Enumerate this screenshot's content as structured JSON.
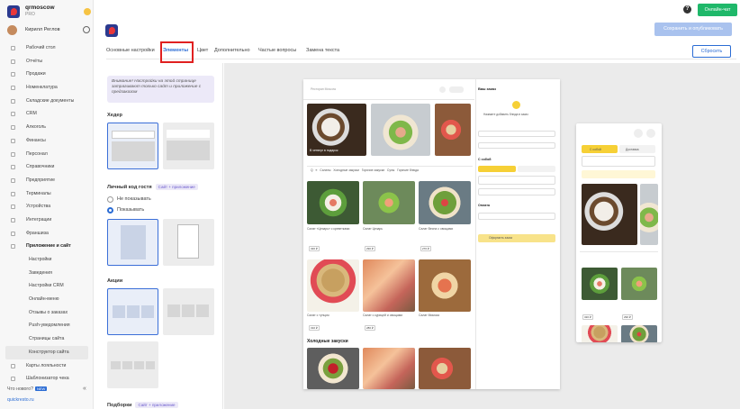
{
  "brand": {
    "name": "qrmoscow",
    "plan": "PRO"
  },
  "user": {
    "name": "Кирилл Реглов"
  },
  "menu": [
    {
      "label": "Рабочий стол",
      "type": "main"
    },
    {
      "label": "Отчёты",
      "type": "main"
    },
    {
      "label": "Продажи",
      "type": "main"
    },
    {
      "label": "Номенклатура",
      "type": "main"
    },
    {
      "label": "Складские документы",
      "type": "main"
    },
    {
      "label": "CRM",
      "type": "main"
    },
    {
      "label": "Алкоголь",
      "type": "main"
    },
    {
      "label": "Финансы",
      "type": "main"
    },
    {
      "label": "Персонал",
      "type": "main"
    },
    {
      "label": "Справочники",
      "type": "main"
    },
    {
      "label": "Предприятие",
      "type": "main"
    },
    {
      "label": "Терминалы",
      "type": "main"
    },
    {
      "label": "Устройства",
      "type": "main"
    },
    {
      "label": "Интеграции",
      "type": "main"
    },
    {
      "label": "Франшиза",
      "type": "main"
    },
    {
      "label": "Приложение и сайт",
      "type": "bold"
    },
    {
      "label": "Настройки",
      "type": "sub"
    },
    {
      "label": "Заведения",
      "type": "sub"
    },
    {
      "label": "Настройки CRM",
      "type": "sub"
    },
    {
      "label": "Онлайн-меню",
      "type": "sub"
    },
    {
      "label": "Отзывы о заказах",
      "type": "sub"
    },
    {
      "label": "Push-уведомления",
      "type": "sub"
    },
    {
      "label": "Страницы сайта",
      "type": "sub"
    },
    {
      "label": "Конструктор сайта",
      "type": "active"
    },
    {
      "label": "Карты лояльности",
      "type": "main"
    },
    {
      "label": "Шаблонизатор чека",
      "type": "main"
    }
  ],
  "whats_new": "Что нового?",
  "new_badge": "NEW",
  "collapse": "«",
  "site_url": "quickresto.ru",
  "topbar": {
    "help": "?",
    "chat": "Онлайн-чат",
    "publish": "Сохранить и опубликовать",
    "reset": "Сбросить"
  },
  "tabs": [
    "Основные настройки",
    "Элементы",
    "Цвет",
    "Дополнительно",
    "Частые вопросы",
    "Замена текста"
  ],
  "active_tab": "Элементы",
  "warning": "Внимание! Настройки на этой странице затрагивают только сайт и приложение с предзаказом",
  "sections": {
    "header": "Хедер",
    "guest_code": "Личный код гостя",
    "guest_chip": "Сайт + приложение",
    "radio_hide": "Не показывать",
    "radio_show": "Показывать",
    "promos": "Акции",
    "collections": "Подборки",
    "collections_chip": "Сайт + приложение"
  },
  "preview": {
    "cart_title": "Ваш заказ",
    "cart_empty": "Нажмите добавить блюда в заказ",
    "cold": "Холодные закуски",
    "pay": "Оплата",
    "pickup": "С собой",
    "order_btn": "Оформить заказ",
    "mobile_pickup": "С собой",
    "mobile_delivery": "Доставка",
    "coffee_caption": "В четверг в подарок",
    "dish_names": [
      "Салат «Цезарь» с креветками",
      "Салат Цезарь",
      "Салат Весна с овощами",
      "Салат с тунцом",
      "Салат с курицей и овощами",
      "Салат Мимоза"
    ],
    "prices": [
      "320 ₽",
      "290 ₽",
      "270 ₽",
      "310 ₽",
      "280 ₽",
      "260 ₽"
    ]
  }
}
